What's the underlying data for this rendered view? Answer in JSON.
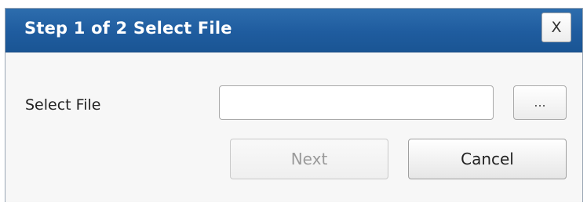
{
  "dialog": {
    "title": "Step 1 of 2 Select File",
    "close_label": "X"
  },
  "form": {
    "file_label": "Select File",
    "file_value": "",
    "file_placeholder": "",
    "browse_label": "..."
  },
  "actions": {
    "next_label": "Next",
    "next_enabled": false,
    "cancel_label": "Cancel"
  },
  "colors": {
    "titlebar": "#1f5c9f",
    "title_text": "#ffffff",
    "dialog_bg": "#f7f7f7",
    "disabled_text": "#9a9a9a"
  },
  "icons": {
    "close": "close-icon",
    "browse": "ellipsis-icon"
  }
}
